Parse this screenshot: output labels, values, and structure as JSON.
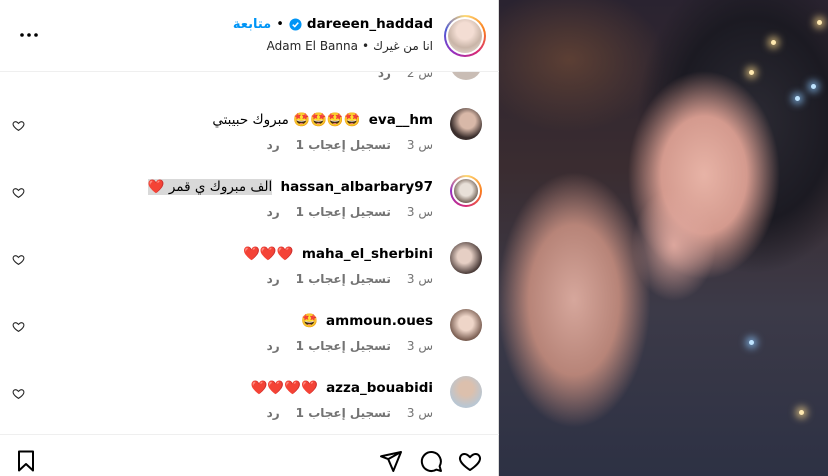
{
  "header": {
    "username": "dareeen_haddad",
    "follow_label": "متابعة",
    "dot": "•",
    "audio_title": "انا من غيرك",
    "audio_sep": "•",
    "audio_artist": "Adam El Banna"
  },
  "partial_comment": {
    "time": "2 س",
    "reply": "رد"
  },
  "comments": [
    {
      "author": "eva__hm",
      "text": "🤩🤩🤩🤩 مبروك حبيبتي",
      "time": "3 س",
      "likes": "1 تسجيل إعجاب",
      "reply": "رد"
    },
    {
      "author": "hassan_albarbary97",
      "text": "الف مبروك ي قمر ❤️",
      "time": "3 س",
      "likes": "1 تسجيل إعجاب",
      "reply": "رد"
    },
    {
      "author": "maha_el_sherbini",
      "text": "❤️❤️❤️",
      "time": "3 س",
      "likes": "1 تسجيل إعجاب",
      "reply": "رد"
    },
    {
      "author": "ammoun.oues",
      "text": "🤩",
      "time": "3 س",
      "likes": "1 تسجيل إعجاب",
      "reply": "رد"
    },
    {
      "author": "azza_bouabidi",
      "text": "❤️❤️❤️❤️",
      "time": "3 س",
      "likes": "1 تسجيل إعجاب",
      "reply": "رد"
    }
  ],
  "icons": {
    "more": "more-options-icon",
    "verified": "verified-badge-icon",
    "like": "heart-icon",
    "comment": "comment-icon",
    "share": "share-icon",
    "save": "bookmark-icon"
  },
  "colors": {
    "accent": "#0095f6",
    "muted": "#737373"
  }
}
